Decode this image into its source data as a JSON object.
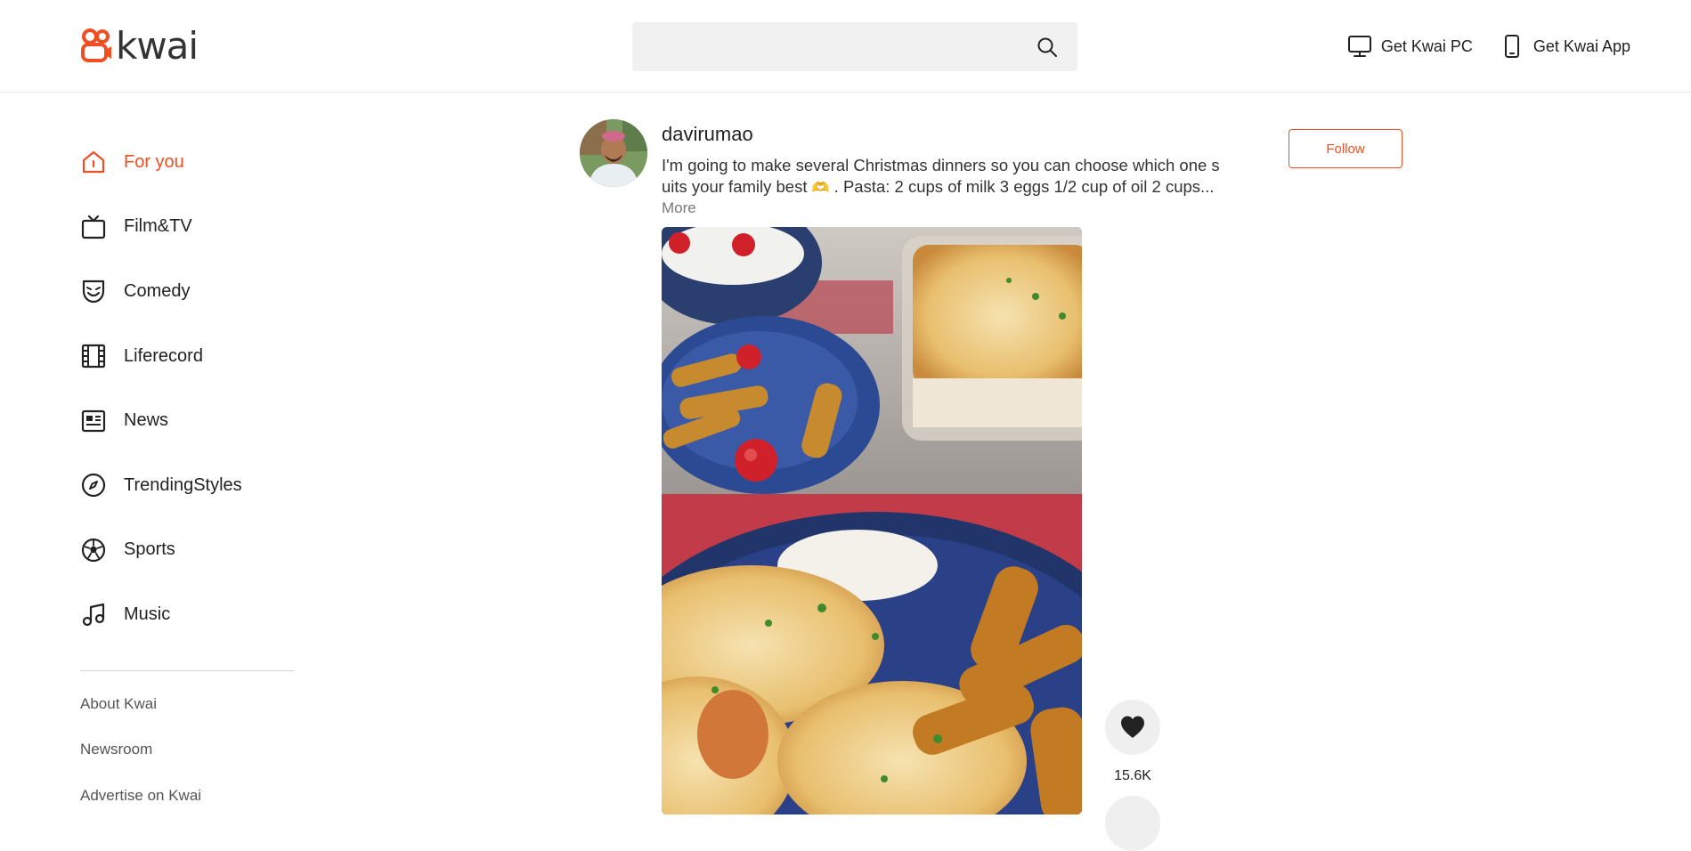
{
  "brand": {
    "wordmark": "kwai",
    "accent": "#f04e23"
  },
  "search": {
    "placeholder": ""
  },
  "header_links": {
    "pc": {
      "label": "Get Kwai PC",
      "icon": "monitor-icon"
    },
    "app": {
      "label": "Get Kwai App",
      "icon": "phone-icon"
    }
  },
  "sidebar": {
    "items": [
      {
        "label": "For you",
        "icon": "home-icon",
        "active": true
      },
      {
        "label": "Film&TV",
        "icon": "tv-icon"
      },
      {
        "label": "Comedy",
        "icon": "comedy-mask-icon"
      },
      {
        "label": "Liferecord",
        "icon": "film-strip-icon"
      },
      {
        "label": "News",
        "icon": "newspaper-icon"
      },
      {
        "label": "TrendingStyles",
        "icon": "compass-icon"
      },
      {
        "label": "Sports",
        "icon": "soccer-ball-icon"
      },
      {
        "label": "Music",
        "icon": "music-note-icon"
      }
    ],
    "footer_links": [
      "About Kwai",
      "Newsroom",
      "Advertise on Kwai"
    ]
  },
  "post": {
    "username": "davirumao",
    "caption_line1": "I'm going to make several Christmas dinners so you can choose which one s",
    "caption_line2_a": "uits your family best ",
    "caption_line2_emoji": "🫶",
    "caption_line2_b": " . Pasta: 2 cups of milk 3 eggs 1/2 cup of oil 2 cups...",
    "more_label": "More",
    "follow_label": "Follow",
    "likes": "15.6K"
  }
}
